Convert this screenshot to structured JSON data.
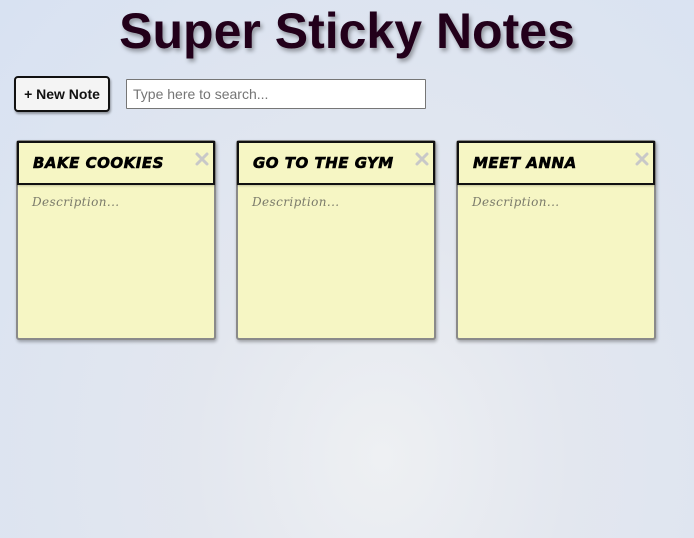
{
  "app": {
    "title": "Super Sticky Notes"
  },
  "toolbar": {
    "new_note_label": "+ New Note",
    "search_placeholder": "Type here to search..."
  },
  "notes": [
    {
      "title": "Bake cookies",
      "description_placeholder": "Description..."
    },
    {
      "title": "Go to the gym",
      "description_placeholder": "Description..."
    },
    {
      "title": "Meet Anna",
      "description_placeholder": "Description..."
    }
  ],
  "icons": {
    "delete": "close-icon"
  },
  "colors": {
    "note_background": "#f6f6c4",
    "title_text": "#22001a",
    "delete_icon": "#c8c8c8"
  }
}
